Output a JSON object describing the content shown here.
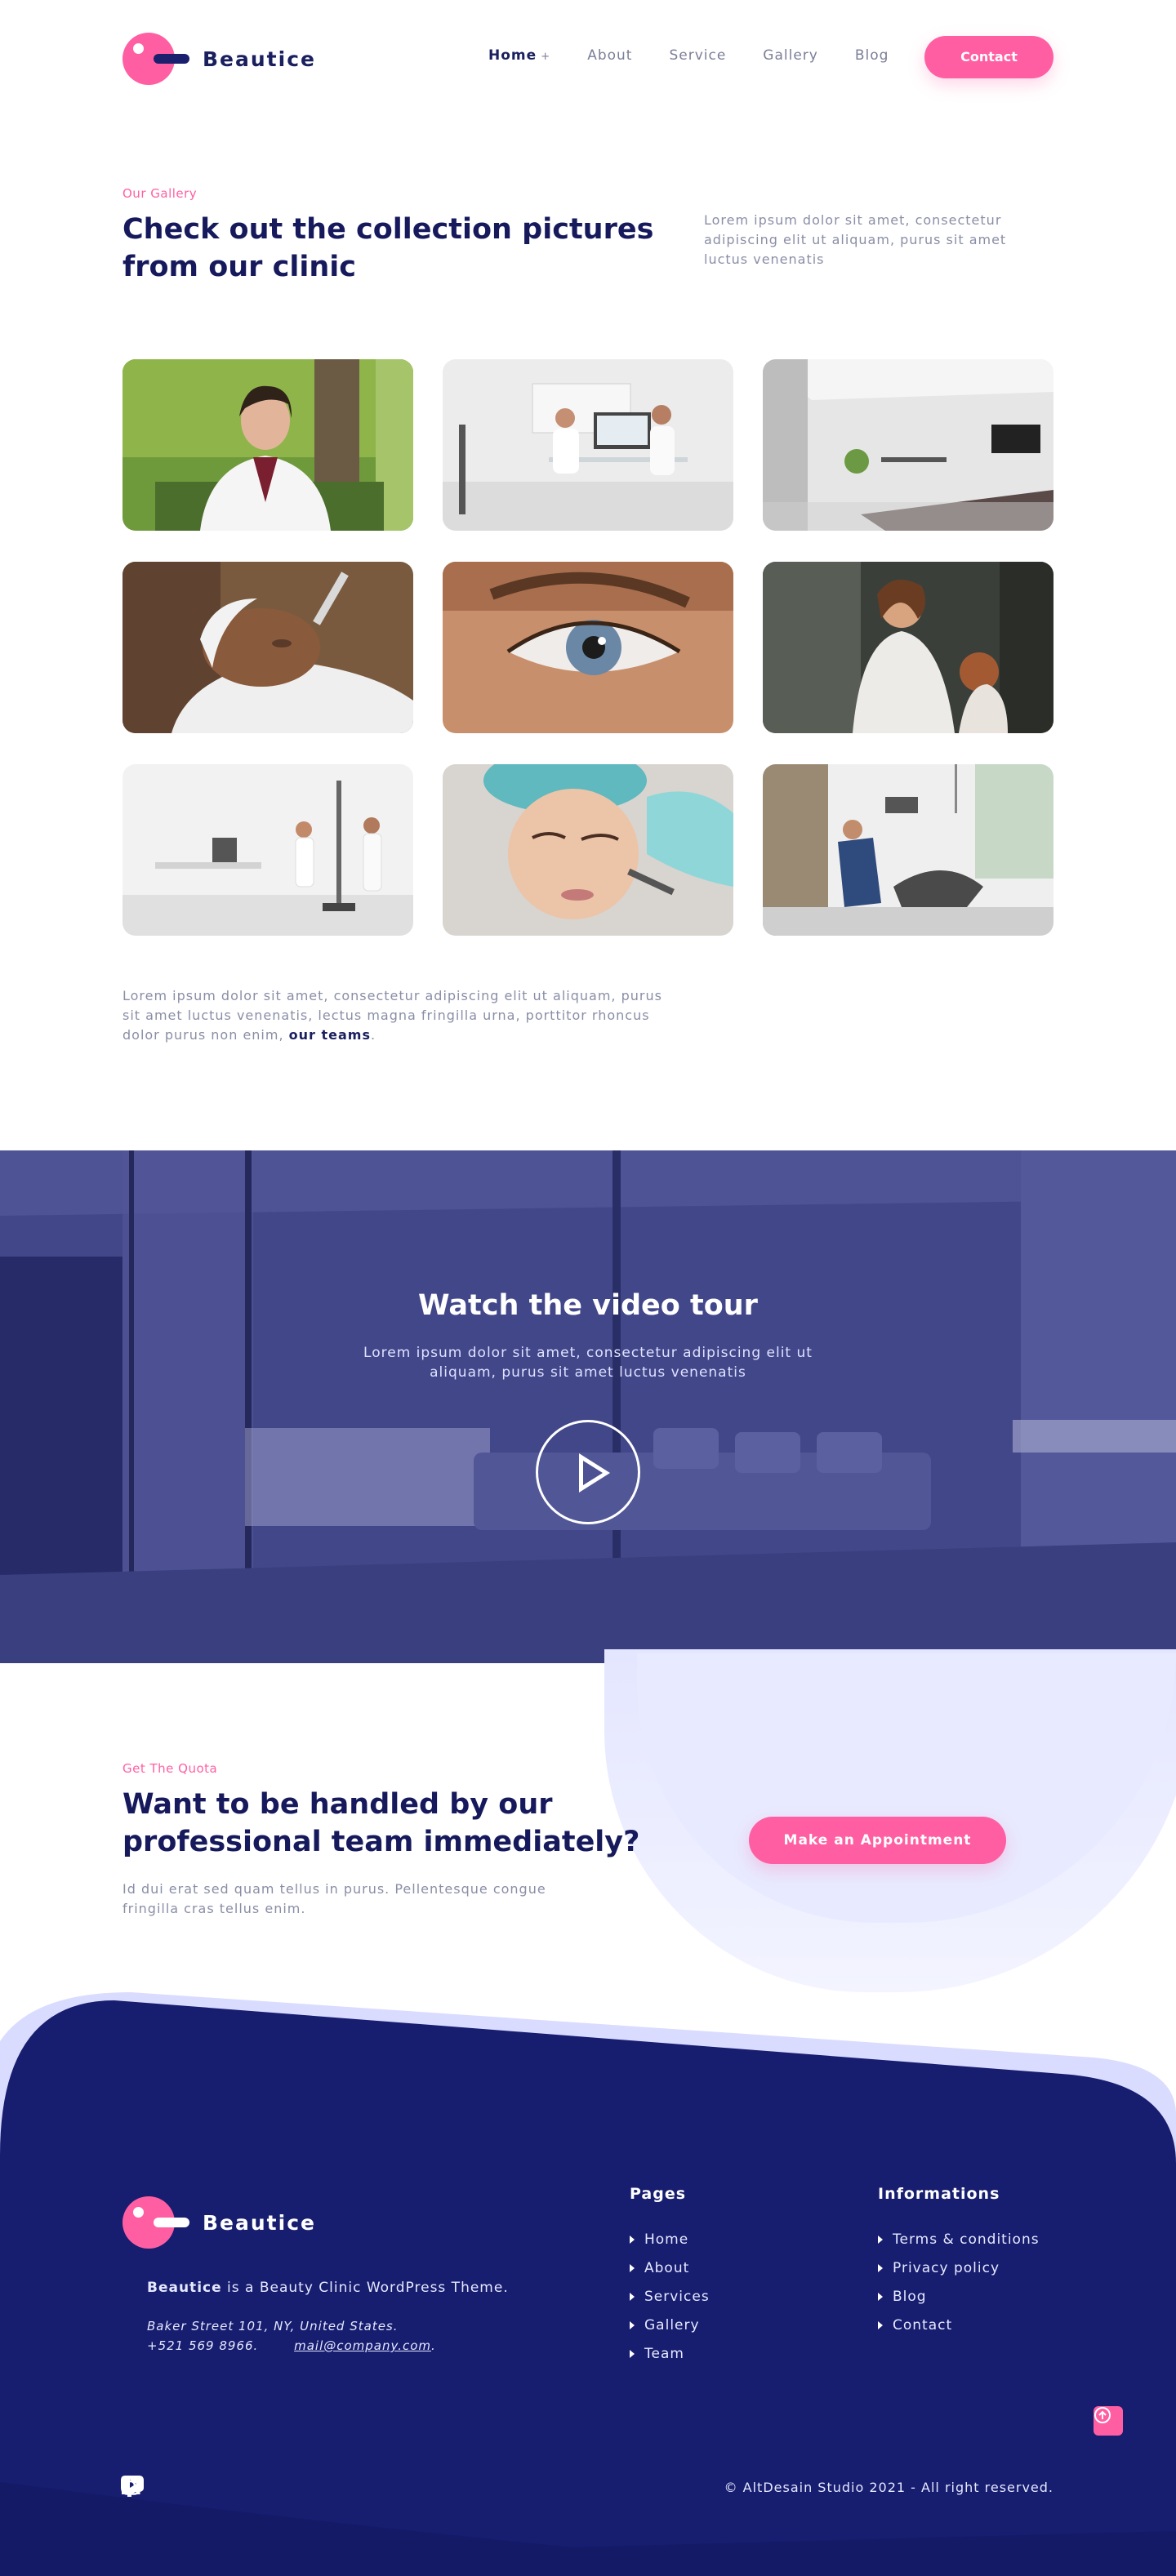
{
  "brand": {
    "name": "Beautice"
  },
  "colors": {
    "accent": "#ff5fa2",
    "navy": "#161b6e",
    "heading": "#161a5c"
  },
  "nav": {
    "items": [
      "Home",
      "About",
      "Service",
      "Gallery",
      "Blog"
    ],
    "active": "Home",
    "cta": "Contact"
  },
  "gallery": {
    "eyebrow": "Our Gallery",
    "title_line1": "Check out the collection pictures",
    "title_line2": "from our clinic",
    "intro": "Lorem ipsum dolor sit amet, consectetur adipiscing elit ut aliquam, purus sit amet luctus venenatis",
    "images": [
      "doctor-portrait",
      "consultation-room",
      "clinic-interior",
      "facial-mask-treatment",
      "eye-closeup",
      "hair-styling",
      "body-scale-room",
      "facial-treatment",
      "dental-clinic"
    ],
    "footnote": "Lorem ipsum dolor sit amet, consectetur adipiscing elit ut aliquam, purus sit amet luctus venenatis, lectus magna fringilla urna, porttitor rhoncus dolor purus non enim,",
    "footnote_link": "our teams",
    "footnote_end": "."
  },
  "video": {
    "title": "Watch the video tour",
    "subtitle_line1": "Lorem ipsum dolor sit amet, consectetur adipiscing elit ut",
    "subtitle_line2": "aliquam, purus sit amet luctus venenatis",
    "play_icon": "play-icon"
  },
  "quota": {
    "eyebrow": "Get The Quota",
    "title_line1": "Want to be handled by our",
    "title_line2": "professional team immediately?",
    "text_line1": "Id dui erat sed quam tellus in purus. Pellentesque congue",
    "text_line2": "fringilla cras tellus enim.",
    "cta": "Make an Appointment"
  },
  "footer": {
    "tagline_brand": "Beautice",
    "tagline_rest": " is a Beauty Clinic WordPress Theme.",
    "address": "Baker Street 101, NY, United States.",
    "phone": "+521 569 8966.",
    "email": "mail@company.com",
    "email_end": ".",
    "pages_title": "Pages",
    "pages": [
      "Home",
      "About",
      "Services",
      "Gallery",
      "Team"
    ],
    "info_title": "Informations",
    "info": [
      "Terms & conditions",
      "Privacy policy",
      "Blog",
      "Contact"
    ],
    "social": [
      "facebook-icon",
      "twitter-icon",
      "linkedin-icon",
      "youtube-icon",
      "instagram-icon"
    ],
    "copyright": "© AltDesain Studio 2021 - All right reserved."
  }
}
